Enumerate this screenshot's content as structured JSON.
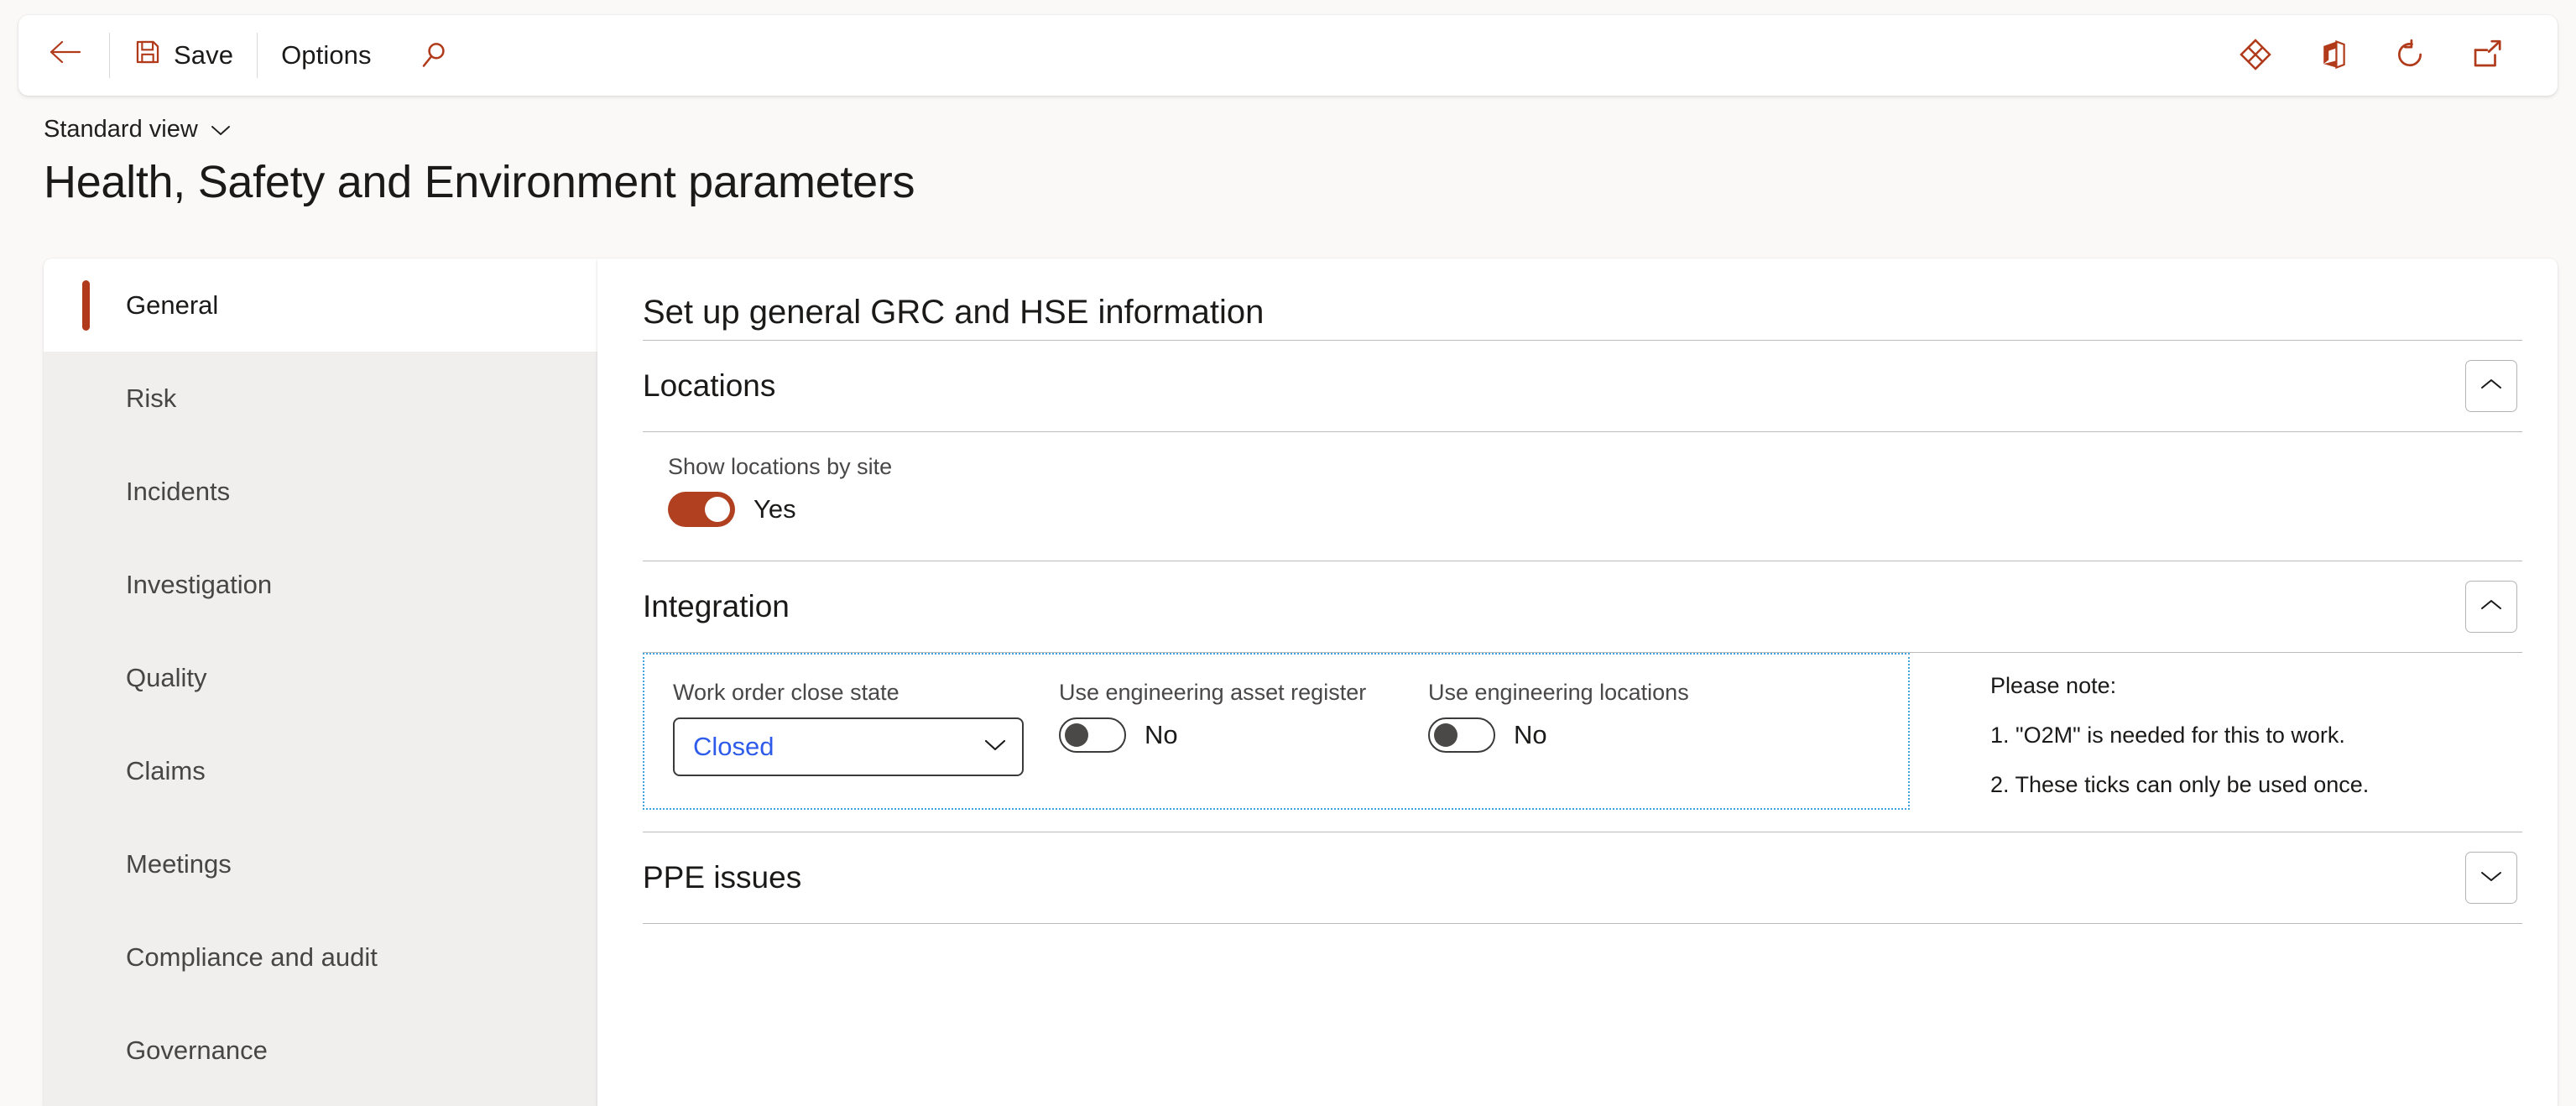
{
  "commandbar": {
    "back_label": "Back",
    "save_label": "Save",
    "options_label": "Options",
    "search_label": "Search",
    "right_icons": [
      {
        "name": "power-apps-icon",
        "label": "Power Apps"
      },
      {
        "name": "office-apps-icon",
        "label": "Office apps"
      },
      {
        "name": "refresh-icon",
        "label": "Refresh"
      },
      {
        "name": "open-in-new-window-icon",
        "label": "Open in new window"
      }
    ]
  },
  "header": {
    "view_name": "Standard view",
    "page_title": "Health, Safety and Environment parameters"
  },
  "sidebar": {
    "items": [
      {
        "label": "General",
        "selected": true
      },
      {
        "label": "Risk",
        "selected": false
      },
      {
        "label": "Incidents",
        "selected": false
      },
      {
        "label": "Investigation",
        "selected": false
      },
      {
        "label": "Quality",
        "selected": false
      },
      {
        "label": "Claims",
        "selected": false
      },
      {
        "label": "Meetings",
        "selected": false
      },
      {
        "label": "Compliance and audit",
        "selected": false
      },
      {
        "label": "Governance",
        "selected": false
      }
    ]
  },
  "main": {
    "heading": "Set up general GRC and HSE information",
    "sections": {
      "locations": {
        "title": "Locations",
        "expanded": true,
        "collapse_icon": "chevron-up-icon",
        "show_locations_by_site": {
          "label": "Show locations by site",
          "value": "Yes",
          "state": "on"
        }
      },
      "integration": {
        "title": "Integration",
        "expanded": true,
        "collapse_icon": "chevron-up-icon",
        "work_order_close_state": {
          "label": "Work order close state",
          "value": "Closed",
          "dropdown_icon": "chevron-down-icon"
        },
        "use_engineering_asset_register": {
          "label": "Use engineering asset register",
          "value": "No",
          "state": "off"
        },
        "use_engineering_locations": {
          "label": "Use engineering locations",
          "value": "No",
          "state": "off"
        },
        "note": {
          "title": "Please note:",
          "line1": "1. \"O2M\" is needed for this to work.",
          "line2": "2. These ticks can only be used once."
        }
      },
      "ppe_issues": {
        "title": "PPE issues",
        "expanded": false,
        "collapse_icon": "chevron-down-icon"
      }
    }
  },
  "colors": {
    "accent": "#b03a1a",
    "toggle_on": "#b0401f",
    "highlight_border": "#3fa3e0",
    "link_value": "#2f5bea",
    "page_bg": "#faf9f8",
    "nav_bg": "#f0efee"
  }
}
